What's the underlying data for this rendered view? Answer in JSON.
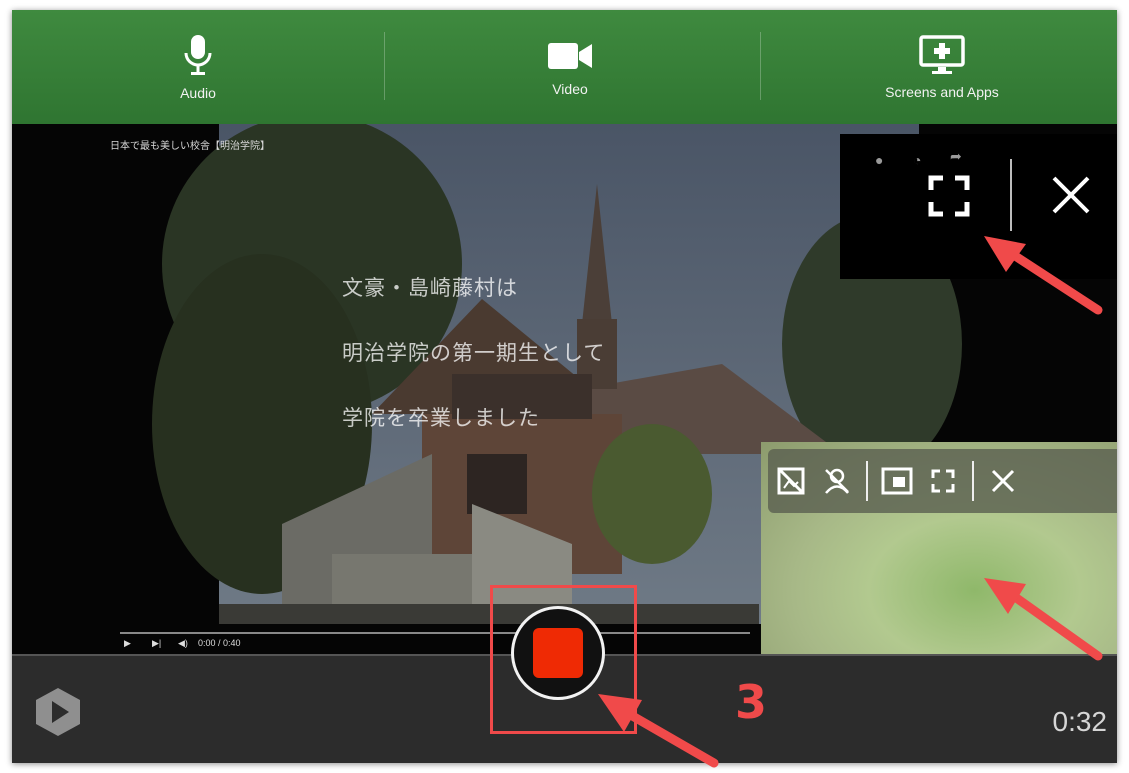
{
  "toolbar": {
    "items": [
      {
        "label": "Audio",
        "icon": "microphone-icon"
      },
      {
        "label": "Video",
        "icon": "video-camera-icon"
      },
      {
        "label": "Screens and Apps",
        "icon": "add-screen-icon"
      }
    ],
    "color": "#357a36"
  },
  "video": {
    "title": "日本で最も美しい校舎【明治学院】",
    "captions": [
      "文豪・島崎藤村は",
      "明治学院の第一期生として",
      "学院を卒業しました"
    ],
    "player_time": "0:00 / 0:40"
  },
  "share_control": {
    "icons": [
      "info-icon",
      "clock-icon",
      "share-icon",
      "fullscreen-icon",
      "close-icon"
    ]
  },
  "camera_panel": {
    "icons": [
      "hide-video-icon",
      "hide-self-icon",
      "picture-in-picture-icon",
      "fullscreen-icon",
      "close-icon"
    ]
  },
  "recorder": {
    "timer": "0:32",
    "stop_color": "#ef2a04",
    "logo_icon": "panopto-logo-icon"
  },
  "annotation": {
    "step": "3",
    "color": "#f04a4a"
  }
}
